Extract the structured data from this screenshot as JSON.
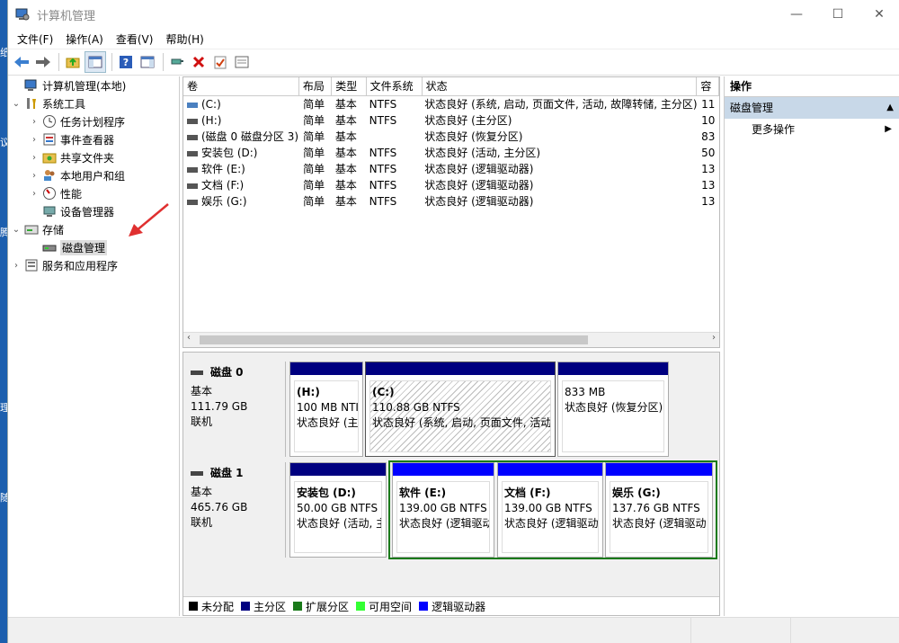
{
  "window": {
    "title": "计算机管理"
  },
  "menu": [
    "文件(F)",
    "操作(A)",
    "查看(V)",
    "帮助(H)"
  ],
  "tree": {
    "root": "计算机管理(本地)",
    "system_tools": "系统工具",
    "task_scheduler": "任务计划程序",
    "event_viewer": "事件查看器",
    "shared_folders": "共享文件夹",
    "local_users": "本地用户和组",
    "performance": "性能",
    "device_manager": "设备管理器",
    "storage": "存储",
    "disk_management": "磁盘管理",
    "services_apps": "服务和应用程序"
  },
  "volume_table": {
    "headers": [
      "卷",
      "布局",
      "类型",
      "文件系统",
      "状态",
      "容"
    ],
    "rows": [
      {
        "name": "(C:)",
        "layout": "简单",
        "type": "基本",
        "fs": "NTFS",
        "status": "状态良好 (系统, 启动, 页面文件, 活动, 故障转储, 主分区)",
        "cap": "11"
      },
      {
        "name": "(H:)",
        "layout": "简单",
        "type": "基本",
        "fs": "NTFS",
        "status": "状态良好 (主分区)",
        "cap": "10"
      },
      {
        "name": "(磁盘 0 磁盘分区 3)",
        "layout": "简单",
        "type": "基本",
        "fs": "",
        "status": "状态良好 (恢复分区)",
        "cap": "83"
      },
      {
        "name": "安装包 (D:)",
        "layout": "简单",
        "type": "基本",
        "fs": "NTFS",
        "status": "状态良好 (活动, 主分区)",
        "cap": "50"
      },
      {
        "name": "软件 (E:)",
        "layout": "简单",
        "type": "基本",
        "fs": "NTFS",
        "status": "状态良好 (逻辑驱动器)",
        "cap": "13"
      },
      {
        "name": "文档 (F:)",
        "layout": "简单",
        "type": "基本",
        "fs": "NTFS",
        "status": "状态良好 (逻辑驱动器)",
        "cap": "13"
      },
      {
        "name": "娱乐 (G:)",
        "layout": "简单",
        "type": "基本",
        "fs": "NTFS",
        "status": "状态良好 (逻辑驱动器)",
        "cap": "13"
      }
    ]
  },
  "disks": [
    {
      "name": "磁盘 0",
      "type": "基本",
      "size": "111.79 GB",
      "state": "联机",
      "partitions": [
        {
          "name": "(H:)",
          "size": "100 MB NTI",
          "status": "状态良好 (主"
        },
        {
          "name": "(C:)",
          "size": "110.88 GB NTFS",
          "status": "状态良好 (系统, 启动, 页面文件, 活动,"
        },
        {
          "name": "",
          "size": "833 MB",
          "status": "状态良好 (恢复分区)"
        }
      ]
    },
    {
      "name": "磁盘 1",
      "type": "基本",
      "size": "465.76 GB",
      "state": "联机",
      "partitions": [
        {
          "name": "安装包 (D:)",
          "size": "50.00 GB NTFS",
          "status": "状态良好 (活动, 主"
        },
        {
          "name": "软件 (E:)",
          "size": "139.00 GB NTFS",
          "status": "状态良好 (逻辑驱动"
        },
        {
          "name": "文档 (F:)",
          "size": "139.00 GB NTFS",
          "status": "状态良好 (逻辑驱动"
        },
        {
          "name": "娱乐 (G:)",
          "size": "137.76 GB NTFS",
          "status": "状态良好 (逻辑驱动"
        }
      ]
    }
  ],
  "legend": [
    {
      "label": "未分配",
      "color": "#000000"
    },
    {
      "label": "主分区",
      "color": "#000080"
    },
    {
      "label": "扩展分区",
      "color": "#1a7a1a"
    },
    {
      "label": "可用空间",
      "color": "#33ff33"
    },
    {
      "label": "逻辑驱动器",
      "color": "#0000ff"
    }
  ],
  "actions": {
    "header": "操作",
    "section": "磁盘管理",
    "more": "更多操作"
  },
  "colors": {
    "primary": "#000080",
    "logical": "#0000ff",
    "extended": "#1a7a1a"
  }
}
